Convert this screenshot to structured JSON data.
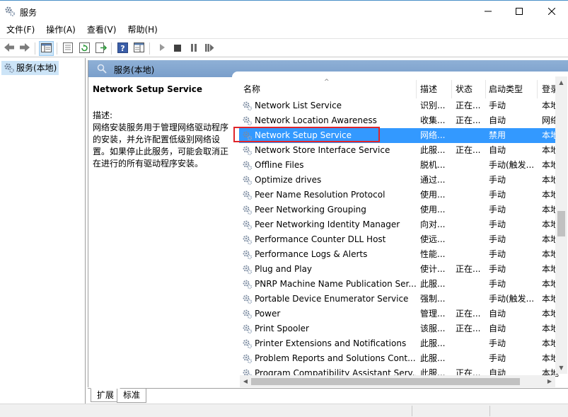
{
  "window": {
    "title": "服务",
    "icon": "gear-icon",
    "controls": {
      "minimize": "minimize-icon",
      "maximize": "maximize-icon",
      "close": "close-icon"
    }
  },
  "menu": [
    "文件(F)",
    "操作(A)",
    "查看(V)",
    "帮助(H)"
  ],
  "tree": {
    "root_label": "服务(本地)"
  },
  "pane": {
    "header": "服务(本地)",
    "selected_service": "Network Setup Service",
    "desc_label": "描述:",
    "desc_text": "网络安装服务用于管理网络驱动程序的安装，并允许配置低级别网络设置。如果停止此服务，可能会取消正在进行的所有驱动程序安装。"
  },
  "columns": {
    "name": "名称",
    "desc": "描述",
    "status": "状态",
    "startup": "启动类型",
    "logon": "登录"
  },
  "services": [
    {
      "name": "Network List Service",
      "desc": "识别...",
      "status": "正在...",
      "startup": "手动",
      "logon": "本地"
    },
    {
      "name": "Network Location Awareness",
      "desc": "收集...",
      "status": "正在...",
      "startup": "自动",
      "logon": "网络"
    },
    {
      "name": "Network Setup Service",
      "desc": "网络...",
      "status": "",
      "startup": "禁用",
      "logon": "本地",
      "selected": true
    },
    {
      "name": "Network Store Interface Service",
      "desc": "此服...",
      "status": "正在...",
      "startup": "自动",
      "logon": "本地"
    },
    {
      "name": "Offline Files",
      "desc": "脱机...",
      "status": "",
      "startup": "手动(触发...",
      "logon": "本地"
    },
    {
      "name": "Optimize drives",
      "desc": "通过...",
      "status": "",
      "startup": "手动",
      "logon": "本地"
    },
    {
      "name": "Peer Name Resolution Protocol",
      "desc": "使用...",
      "status": "",
      "startup": "手动",
      "logon": "本地"
    },
    {
      "name": "Peer Networking Grouping",
      "desc": "使用...",
      "status": "",
      "startup": "手动",
      "logon": "本地"
    },
    {
      "name": "Peer Networking Identity Manager",
      "desc": "向对...",
      "status": "",
      "startup": "手动",
      "logon": "本地"
    },
    {
      "name": "Performance Counter DLL Host",
      "desc": "使远...",
      "status": "",
      "startup": "手动",
      "logon": "本地"
    },
    {
      "name": "Performance Logs & Alerts",
      "desc": "性能...",
      "status": "",
      "startup": "手动",
      "logon": "本地"
    },
    {
      "name": "Plug and Play",
      "desc": "使计...",
      "status": "正在...",
      "startup": "手动",
      "logon": "本地"
    },
    {
      "name": "PNRP Machine Name Publication Ser...",
      "desc": "此服...",
      "status": "",
      "startup": "手动",
      "logon": "本地"
    },
    {
      "name": "Portable Device Enumerator Service",
      "desc": "强制...",
      "status": "",
      "startup": "手动(触发...",
      "logon": "本地"
    },
    {
      "name": "Power",
      "desc": "管理...",
      "status": "正在...",
      "startup": "自动",
      "logon": "本地"
    },
    {
      "name": "Print Spooler",
      "desc": "该服...",
      "status": "正在...",
      "startup": "自动",
      "logon": "本地"
    },
    {
      "name": "Printer Extensions and Notifications",
      "desc": "此服...",
      "status": "",
      "startup": "手动",
      "logon": "本地"
    },
    {
      "name": "Problem Reports and Solutions Cont...",
      "desc": "此服...",
      "status": "",
      "startup": "手动",
      "logon": "本地"
    },
    {
      "name": "Program Compatibility Assistant Serv...",
      "desc": "此服...",
      "status": "正在...",
      "startup": "自动",
      "logon": "本地"
    }
  ],
  "tabs": [
    "扩展",
    "标准"
  ],
  "colors": {
    "selection": "#3399ff",
    "highlight_box": "#e0262b",
    "header_gradient": "#8fb0d6",
    "tree_selection": "#cce4f7"
  }
}
